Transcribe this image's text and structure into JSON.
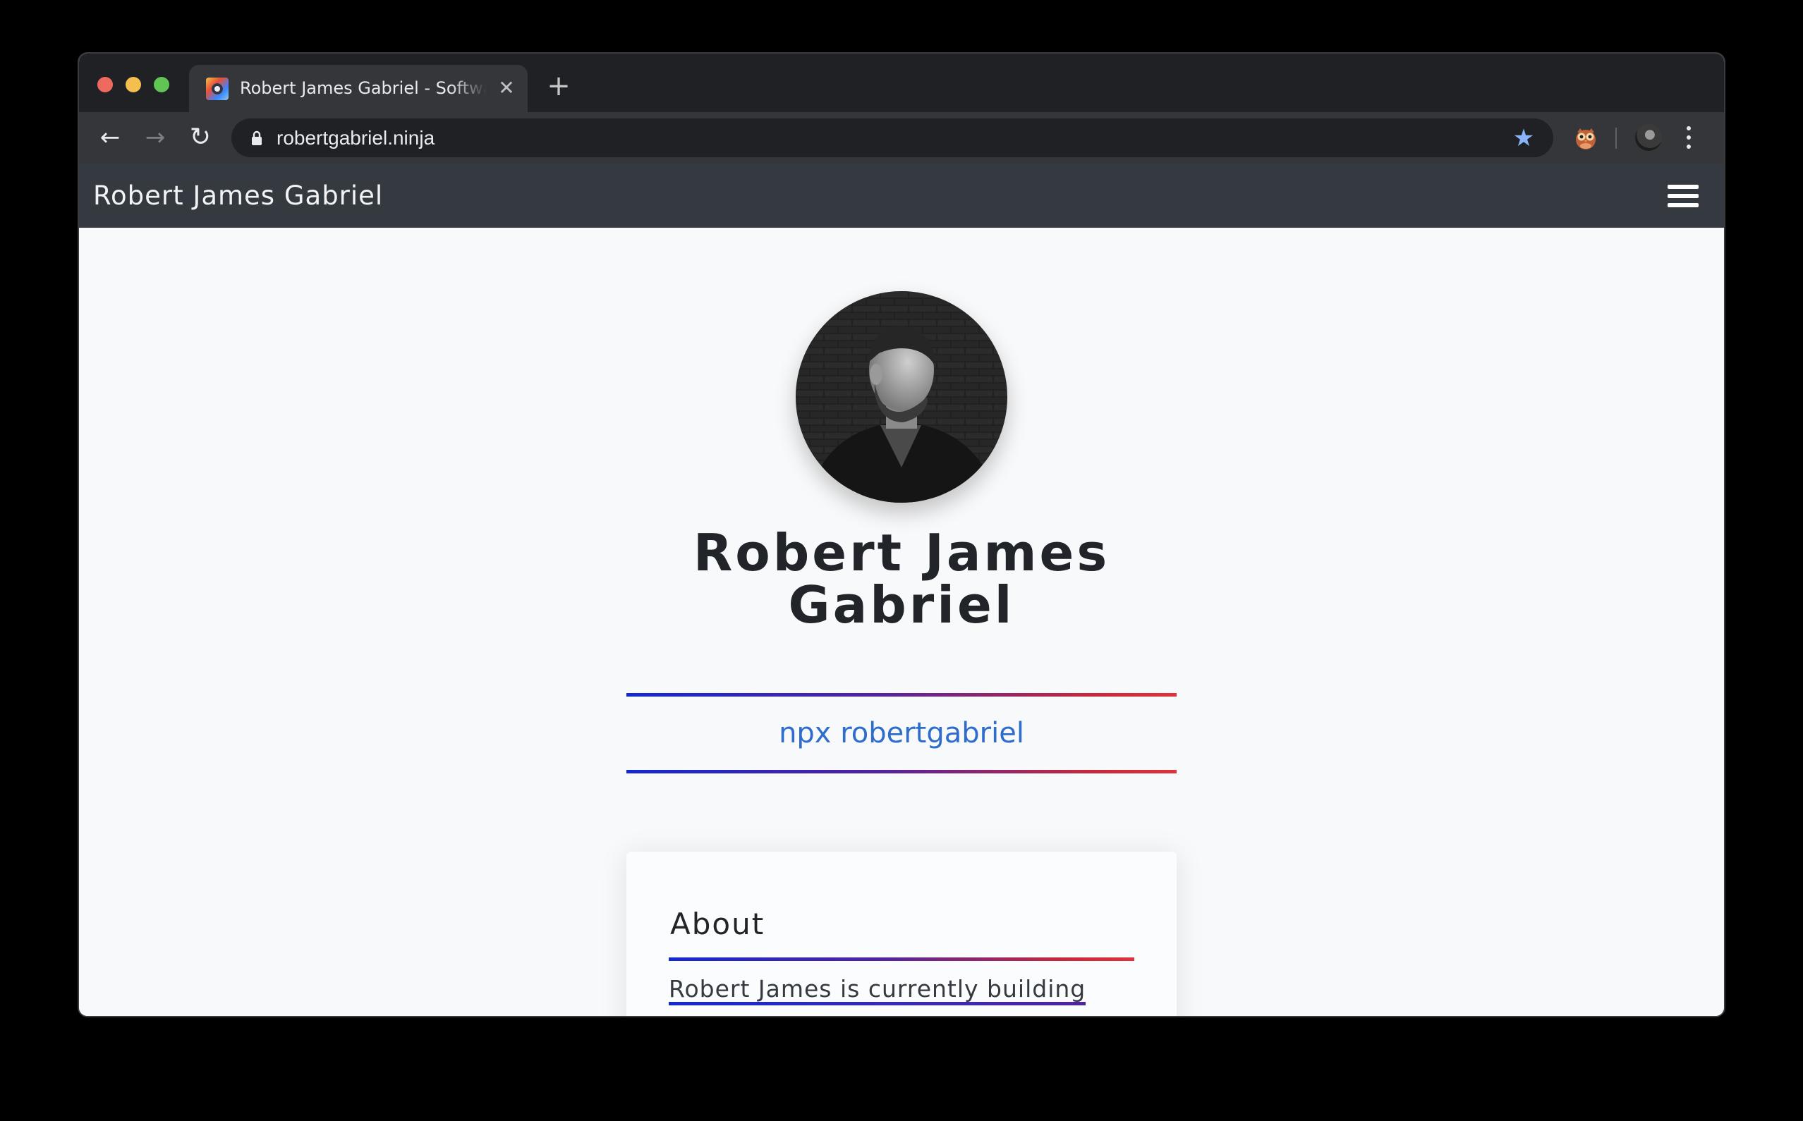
{
  "browser": {
    "tab": {
      "title": "Robert James Gabriel - Software Engineer",
      "close_symbol": "✕",
      "favicon": "robot-favicon-icon"
    },
    "new_tab_symbol": "+",
    "nav": {
      "back_symbol": "←",
      "forward_symbol": "→",
      "reload_symbol": "↻"
    },
    "url": "robertgabriel.ninja",
    "bookmark_symbol": "★",
    "extensions": [
      "owl-extension-icon"
    ],
    "profile": "profile-avatar"
  },
  "site": {
    "brand": "Robert James Gabriel",
    "menu_icon": "hamburger-menu-icon"
  },
  "hero": {
    "avatar": "profile-photo",
    "name": "Robert James Gabriel",
    "npx_link": "npx robertgabriel"
  },
  "about": {
    "title": "About",
    "text": "Robert James is currently building open source projects and sass products. PWA's across iOS, Android"
  },
  "colors": {
    "browser_frame": "#202124",
    "toolbar": "#35363a",
    "site_nav": "#343a40",
    "page_bg": "#f8f9fa",
    "link": "#2e6ccd",
    "gradient_start": "#1428d2",
    "gradient_end": "#e0323c",
    "bookmark_star": "#8ab4f8"
  }
}
